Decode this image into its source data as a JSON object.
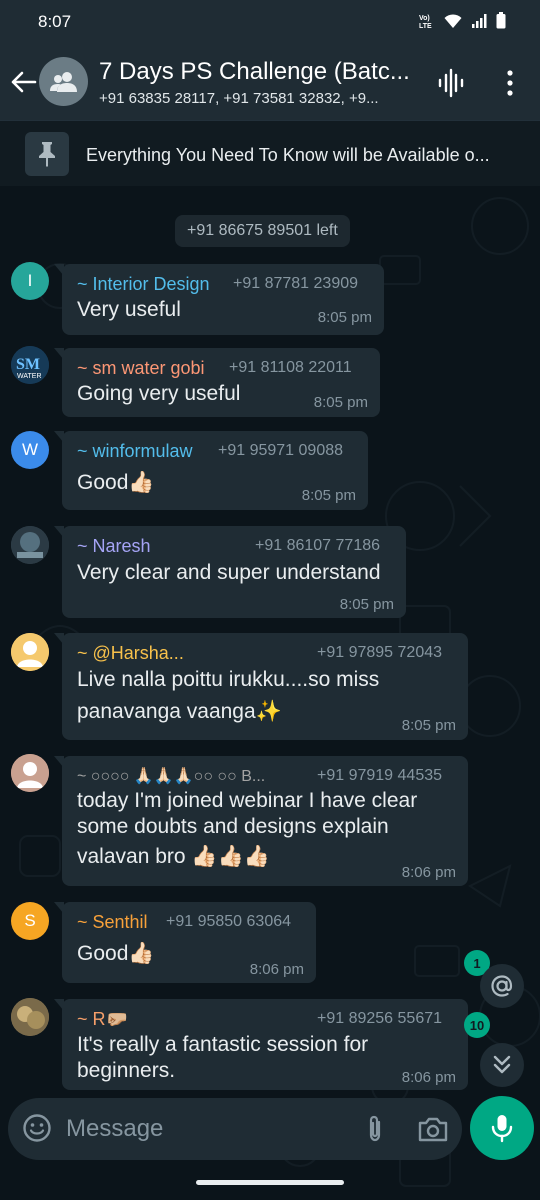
{
  "status_bar": {
    "time": "8:07",
    "icons": [
      "volte-icon",
      "wifi-icon",
      "signal-icon",
      "battery-icon"
    ],
    "volte_text": "Vo) LTE"
  },
  "header": {
    "title": "7 Days PS Challenge (Batc...",
    "subtitle": "+91 63835 28117, +91 73581 32832, +9...",
    "icons": [
      "back-arrow-icon",
      "group-avatar-icon",
      "voice-chat-icon",
      "more-options-icon"
    ]
  },
  "pinned": {
    "text": "Everything You Need To Know will be Available o...",
    "icon": "pin-icon"
  },
  "system_message": "+91 86675 89501 left",
  "messages": [
    {
      "avatar_letter": "I",
      "avatar_color": "#26a69a",
      "sender": "~ Interior Design",
      "sender_color": "#53bdeb",
      "phone": "+91 87781 23909",
      "text": "Very useful",
      "time": "8:05 pm"
    },
    {
      "avatar_letter": "",
      "avatar_color": "#1b3d5c",
      "sender": "~ sm water gobi",
      "sender_color": "#fc9775",
      "phone": "+91 81108 22011",
      "text": "Going very useful",
      "time": "8:05 pm"
    },
    {
      "avatar_letter": "W",
      "avatar_color": "#3b8bea",
      "sender": "~ winformulaw",
      "sender_color": "#53bdeb",
      "phone": "+91 95971 09088",
      "text": "Good👍🏻",
      "time": "8:05 pm"
    },
    {
      "avatar_letter": "",
      "avatar_color": "#3a4a55",
      "sender": "~ Naresh",
      "sender_color": "#a5a4f5",
      "phone": "+91 86107 77186",
      "text": "Very clear and super understand",
      "time": "8:05 pm"
    },
    {
      "avatar_letter": "",
      "avatar_color": "#f5c96d",
      "sender": "~ @Harsha...",
      "sender_color": "#f7c14b",
      "phone": "+91 97895 72043",
      "text_lines": [
        "Live nalla poittu irukku....so miss",
        "panavanga vaanga✨"
      ],
      "time": "8:05 pm"
    },
    {
      "avatar_letter": "",
      "avatar_color": "#c9a190",
      "sender": "~ ○○○○ 🙏🏻🙏🏻🙏🏻○○ ○○ B...",
      "sender_color": "#a3a3a3",
      "phone": "+91 97919 44535",
      "text_lines": [
        "today I'm joined webinar I have clear",
        "some doubts and designs explain",
        "valavan bro 👍🏻👍🏻👍🏻"
      ],
      "time": "8:06 pm"
    },
    {
      "avatar_letter": "S",
      "avatar_color": "#f6a623",
      "sender": "~ Senthil",
      "sender_color": "#f7a13a",
      "phone": "+91 95850 63064",
      "text": "Good👍🏻",
      "time": "8:06 pm"
    },
    {
      "avatar_letter": "",
      "avatar_color": "#8a7a55",
      "sender": "~ R🤛🏼",
      "sender_color": "#f59f6a",
      "phone": "+91 89256 55671",
      "text_lines": [
        "It's really a fantastic session for",
        "beginners."
      ],
      "time": "8:06 pm"
    }
  ],
  "floating": {
    "mention_count": "1",
    "mention_icon": "at-sign-icon",
    "unread_count": "10",
    "scroll_icon": "double-chevron-down-icon"
  },
  "composer": {
    "placeholder": "Message",
    "icons": [
      "emoji-icon",
      "attach-icon",
      "camera-icon",
      "mic-icon"
    ]
  },
  "colors": {
    "app_bar": "#1f2c34",
    "chat_bg": "#0b141a",
    "bubble": "#1f2c34",
    "accent": "#00a884"
  }
}
